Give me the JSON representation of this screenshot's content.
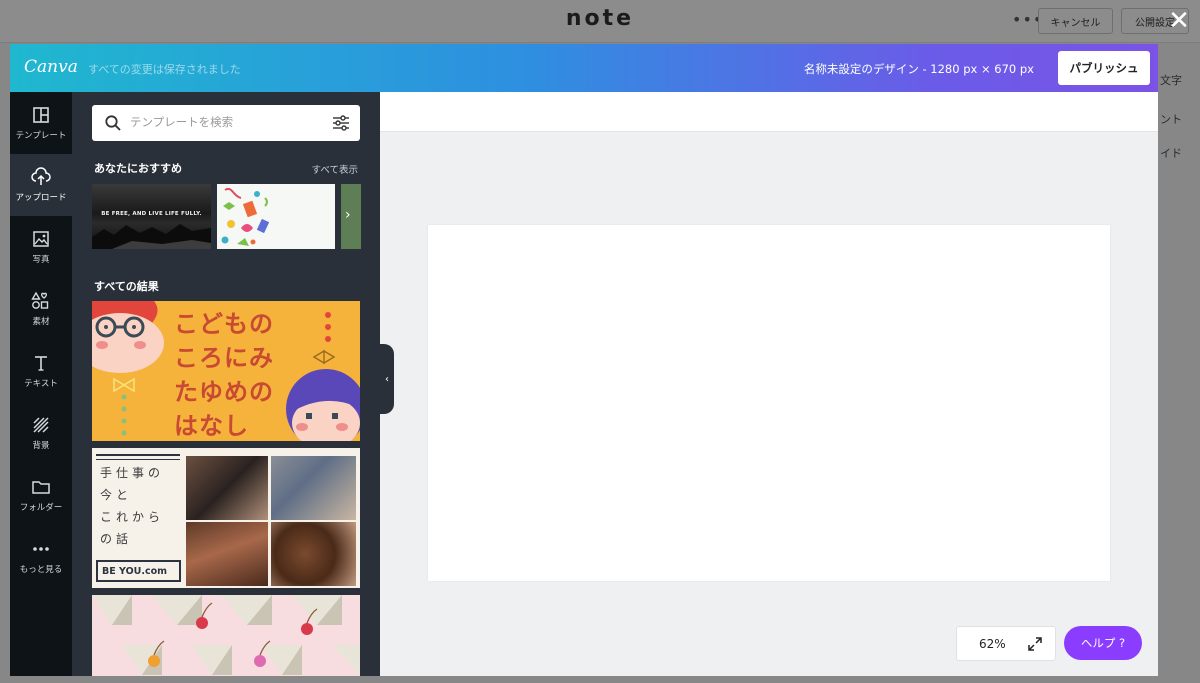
{
  "note": {
    "logo": "note",
    "more": "•••",
    "cancel_label": "キャンセル",
    "publish_settings_label": "公開設定",
    "close_label": "✕",
    "side_items": [
      "文字",
      "ント",
      "イド"
    ]
  },
  "canva": {
    "logo": "Canva",
    "save_status": "すべての変更は保存されました",
    "design_info": "名称未設定のデザイン - 1280 px × 670 px",
    "publish_label": "パブリッシュ"
  },
  "rail": {
    "items": [
      {
        "label": "テンプレート",
        "icon": "template-icon"
      },
      {
        "label": "アップロード",
        "icon": "upload-icon"
      },
      {
        "label": "写真",
        "icon": "photo-icon"
      },
      {
        "label": "素材",
        "icon": "elements-icon"
      },
      {
        "label": "テキスト",
        "icon": "text-icon"
      },
      {
        "label": "背景",
        "icon": "background-icon"
      },
      {
        "label": "フォルダー",
        "icon": "folder-icon"
      },
      {
        "label": "もっと見る",
        "icon": "more-icon"
      }
    ]
  },
  "panel": {
    "search_placeholder": "テンプレートを検索",
    "recommended_title": "あなたにおすすめ",
    "see_all": "すべて表示",
    "rec_1_text": "BE FREE, AND LIVE LIFE FULLY.",
    "all_results_title": "すべての結果",
    "card_1_lines": [
      "こどもの",
      "ころにみ",
      "たゆめの",
      "はなし"
    ],
    "card_2_lines": [
      "手仕事の",
      "今と",
      "これから",
      "の話"
    ],
    "card_2_brand": "BE YOU.com"
  },
  "editor": {
    "zoom": "62%",
    "help_label": "ヘルプ ?"
  },
  "colors": {
    "header_gradient_start": "#1fb8cf",
    "header_gradient_end": "#7b53e6",
    "rail_bg": "#0e1318",
    "panel_bg": "#293039",
    "help_button": "#8b3dff"
  }
}
